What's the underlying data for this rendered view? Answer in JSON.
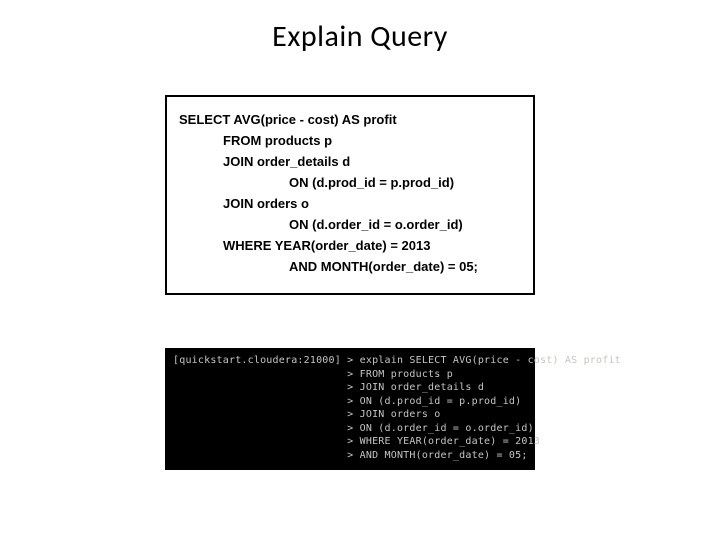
{
  "title": "Explain Query",
  "sql": {
    "l1": "SELECT AVG(price - cost) AS profit",
    "l2": "FROM products p",
    "l3": "JOIN order_details d",
    "l4": "ON (d.prod_id = p.prod_id)",
    "l5": "JOIN orders o",
    "l6": "ON (d.order_id = o.order_id)",
    "l7": "WHERE YEAR(order_date) = 2013",
    "l8": "AND MONTH(order_date) = 05;"
  },
  "terminal": {
    "prompt": "[quickstart.cloudera:21000] > ",
    "cont": "                            > ",
    "l1": "explain SELECT AVG(price - cost) AS profit",
    "l2": "FROM products p",
    "l3": "JOIN order_details d",
    "l4": "ON (d.prod_id = p.prod_id)",
    "l5": "JOIN orders o",
    "l6": "ON (d.order_id = o.order_id)",
    "l7": "WHERE YEAR(order_date) = 2013",
    "l8": "AND MONTH(order_date) = 05;"
  }
}
